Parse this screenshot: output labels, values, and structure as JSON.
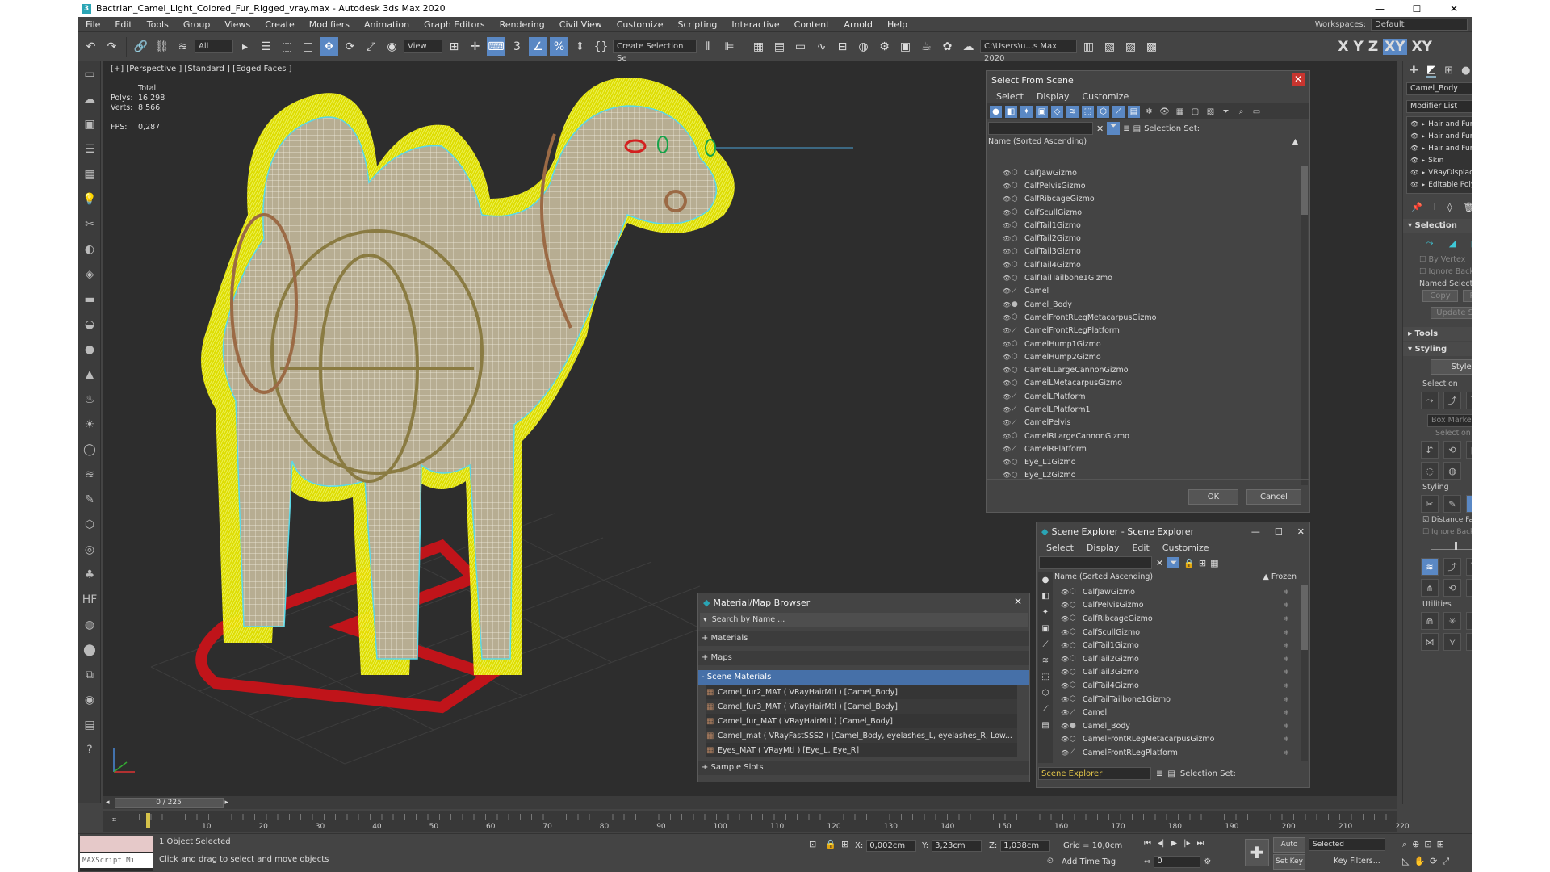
{
  "window": {
    "title": "Bactrian_Camel_Light_Colored_Fur_Rigged_vray.max - Autodesk 3ds Max 2020",
    "min": "—",
    "max": "☐",
    "close": "✕"
  },
  "menu": [
    "File",
    "Edit",
    "Tools",
    "Group",
    "Views",
    "Create",
    "Modifiers",
    "Animation",
    "Graph Editors",
    "Rendering",
    "Civil View",
    "Customize",
    "Scripting",
    "Interactive",
    "Content",
    "Arnold",
    "Help"
  ],
  "workspace": {
    "label": "Workspaces:",
    "value": "Default"
  },
  "toolbar": {
    "filter": "All",
    "view": "View",
    "selection_set": "Create Selection Se",
    "path": "C:\\Users\\u...s Max 2020",
    "axes": [
      "X",
      "Y",
      "Z",
      "XY",
      "XY"
    ]
  },
  "viewport": {
    "label": "[+] [Perspective ] [Standard ] [Edged Faces ]",
    "stats_total": "Total",
    "polys_label": "Polys:",
    "polys": "16 298",
    "verts_label": "Verts:",
    "verts": "8 566",
    "fps_label": "FPS:",
    "fps": "0,287"
  },
  "select_from_scene": {
    "title": "Select From Scene",
    "menu": [
      "Select",
      "Display",
      "Customize"
    ],
    "selection_set": "Selection Set:",
    "column": "Name (Sorted Ascending)",
    "items": [
      "CalfJawGizmo",
      "CalfPelvisGizmo",
      "CalfRibcageGizmo",
      "CalfScullGizmo",
      "CalfTail1Gizmo",
      "CalfTail2Gizmo",
      "CalfTail3Gizmo",
      "CalfTail4Gizmo",
      "CalfTailTailbone1Gizmo",
      "Camel",
      "Camel_Body",
      "CamelFrontRLegMetacarpusGizmo",
      "CamelFrontRLegPlatform",
      "CamelHump1Gizmo",
      "CamelHump2Gizmo",
      "CamelLLargeCannonGizmo",
      "CamelLMetacarpusGizmo",
      "CamelLPlatform",
      "CamelLPlatform1",
      "CamelPelvis",
      "CamelRLargeCannonGizmo",
      "CamelRPlatform",
      "Eye_L1Gizmo",
      "Eye_L2Gizmo"
    ],
    "ok": "OK",
    "cancel": "Cancel"
  },
  "scene_explorer": {
    "title": "Scene Explorer - Scene Explorer",
    "menu": [
      "Select",
      "Display",
      "Edit",
      "Customize"
    ],
    "column": "Name (Sorted Ascending)",
    "frozen": "▲ Frozen",
    "items": [
      "CalfJawGizmo",
      "CalfPelvisGizmo",
      "CalfRibcageGizmo",
      "CalfScullGizmo",
      "CalfTail1Gizmo",
      "CalfTail2Gizmo",
      "CalfTail3Gizmo",
      "CalfTail4Gizmo",
      "CalfTailTailbone1Gizmo",
      "Camel",
      "Camel_Body",
      "CamelFrontRLegMetacarpusGizmo",
      "CamelFrontRLegPlatform"
    ],
    "footer": "Scene Explorer",
    "selection_set": "Selection Set:"
  },
  "material_browser": {
    "title": "Material/Map Browser",
    "search": "Search by Name ...",
    "sections": [
      "+ Materials",
      "+ Maps",
      "- Scene Materials"
    ],
    "materials": [
      "Camel_fur2_MAT ( VRayHairMtl ) [Camel_Body]",
      "Camel_fur3_MAT ( VRayHairMtl ) [Camel_Body]",
      "Camel_fur_MAT ( VRayHairMtl ) [Camel_Body]",
      "Camel_mat ( VRayFastSSS2 ) [Camel_Body, eyelashes_L, eyelashes_R, Low...",
      "Eyes_MAT ( VRayMtl ) [Eye_L, Eye_R]"
    ],
    "sample_slots": "+ Sample Slots"
  },
  "command_panel": {
    "object_name": "Camel_Body",
    "modifier_list": "Modifier List",
    "stack": [
      "Hair and Fur (WSM)",
      "Hair and Fur (WSM)",
      "Hair and Fur (WSM)",
      "Skin",
      "VRayDisplacementMod",
      "Editable Poly"
    ],
    "selection": "Selection",
    "by_vertex": "By Vertex",
    "ignore_backfacing": "Ignore Backfacing",
    "named_sel": "Named Selection Set",
    "copy": "Copy",
    "paste": "Paste",
    "update_sel": "Update Selection",
    "tools": "Tools",
    "styling": "Styling",
    "style_hair": "Style Hair",
    "sub_selection": "Selection",
    "box_marker": "Box Marker",
    "sel_utilities": "Selection Utilities",
    "sub_styling": "Styling",
    "distance_fade": "Distance Fade",
    "ignore_back_hairs": "Ignore Back Hairs",
    "utilities": "Utilities"
  },
  "timeline": {
    "slider": "0 / 225",
    "ticks": [
      "10",
      "20",
      "30",
      "40",
      "50",
      "60",
      "70",
      "80",
      "90",
      "100",
      "110",
      "120",
      "130",
      "140",
      "150",
      "160",
      "170",
      "180",
      "190",
      "200",
      "210",
      "220"
    ]
  },
  "status": {
    "maxscript": "MAXScript Mi",
    "selected": "1 Object Selected",
    "prompt": "Click and drag to select and move objects",
    "x": "0,002cm",
    "y": "3,23cm",
    "z": "1,038cm",
    "grid": "Grid = 10,0cm",
    "add_time_tag": "Add Time Tag",
    "auto_key": "Auto Key",
    "set_key": "Set Key",
    "key_mode": "Selected",
    "frame": "0",
    "key_filters": "Key Filters..."
  },
  "colors": {
    "bg": "#444444",
    "viewport": "#2d2d2d",
    "fur": "#f0f000",
    "accent": "#5a88c4"
  }
}
